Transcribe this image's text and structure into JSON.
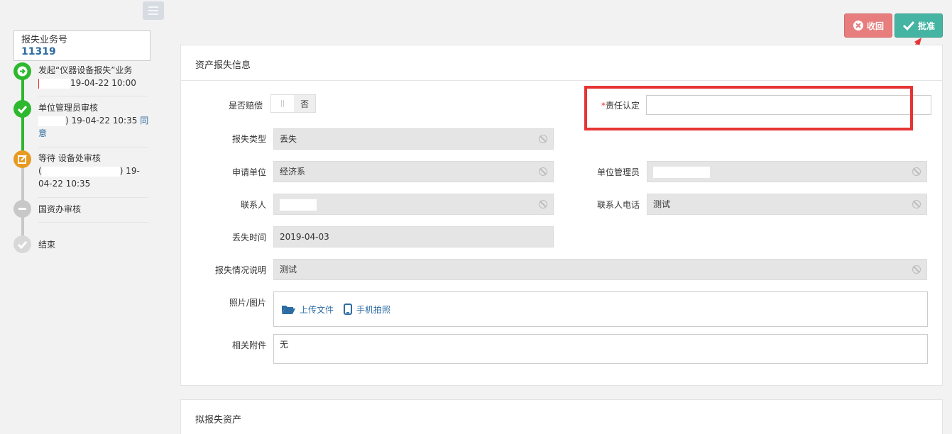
{
  "business": {
    "label": "报失业务号",
    "number": "11319"
  },
  "timeline": [
    {
      "line1": "发起“仪器设备报失”业务",
      "time": "19-04-22 10:00"
    },
    {
      "line1": "单位管理员审核",
      "time": ") 19-04-22 10:35",
      "action": "同意"
    },
    {
      "line1": "等待 设备处审核",
      "time_a": "(",
      "time_b": ") 19-",
      "time_c": "04-22 10:35"
    },
    {
      "line1": "国资办审核"
    },
    {
      "line1": "结束"
    }
  ],
  "actions": {
    "withdraw": "收回",
    "approve": "批准"
  },
  "panel1": {
    "title": "资产报失信息"
  },
  "panel2": {
    "title": "拟报失资产"
  },
  "form": {
    "compensate_label": "是否赔偿",
    "compensate_value": "否",
    "responsibility_label": "责任认定",
    "responsibility_required": "*",
    "loss_type_label": "报失类型",
    "loss_type_value": "丢失",
    "dept_label": "申请单位",
    "dept_value": "经济系",
    "admin_label": "单位管理员",
    "contact_label": "联系人",
    "phone_label": "联系人电话",
    "phone_value": "测试",
    "loss_time_label": "丢失时间",
    "loss_time_value": "2019-04-03",
    "desc_label": "报失情况说明",
    "desc_value": "测试",
    "photo_label": "照片/图片",
    "upload_file": "上传文件",
    "phone_photo": "手机拍照",
    "attach_label": "相关附件",
    "attach_value": "无"
  },
  "colors": {
    "green": "#2db82d",
    "orange": "#e79a22",
    "grey": "#c8c8c8",
    "highlight": "#e63434",
    "approve": "#45b4a2",
    "withdraw": "#e77d7d"
  }
}
